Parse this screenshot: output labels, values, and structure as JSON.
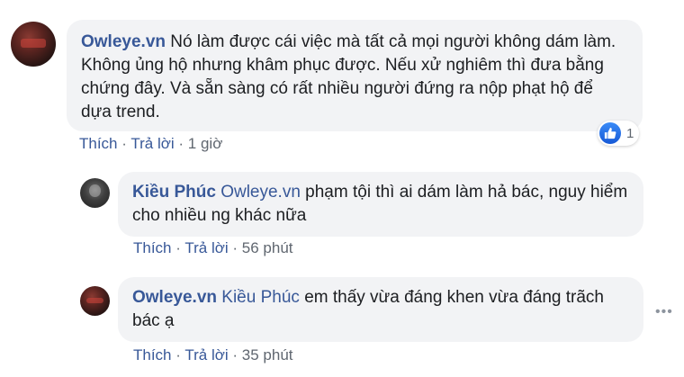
{
  "comment1": {
    "author": "Owleye.vn",
    "text": "Nó làm được cái việc mà tất cả mọi người không dám làm. Không ủng hộ nhưng khâm phục được. Nếu xử nghiêm thì đưa bằng chứng đây. Và sẵn sàng có rất nhiều người đứng ra nộp phạt hộ để dựa trend.",
    "like_label": "Thích",
    "reply_label": "Trả lời",
    "time": "1 giờ",
    "reaction_count": "1",
    "reaction_icon": "thumbs-up-icon",
    "reaction_color": "#1877f2"
  },
  "reply1": {
    "author": "Kiều Phúc",
    "mention": "Owleye.vn",
    "text": "phạm tội thì ai dám làm hả bác, nguy hiểm cho nhiều ng khác nữa",
    "like_label": "Thích",
    "reply_label": "Trả lời",
    "time": "56 phút"
  },
  "reply2": {
    "author": "Owleye.vn",
    "mention": "Kiều Phúc",
    "text": "em thấy vừa đáng khen vừa đáng trãch bác ạ",
    "like_label": "Thích",
    "reply_label": "Trả lời",
    "time": "35 phút"
  },
  "colors": {
    "link": "#385898",
    "bubble_bg": "#f2f3f5",
    "meta_text": "#606770"
  }
}
